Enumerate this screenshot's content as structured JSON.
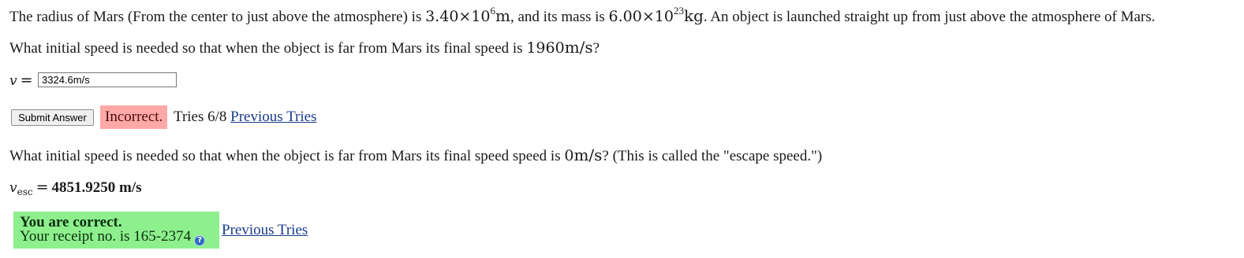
{
  "problem": {
    "intro_a": "The radius of Mars (From the center to just above the atmosphere) is ",
    "radius_mantissa": "3.40×10",
    "radius_exp": "6",
    "radius_unit": "m",
    "intro_b": ", and its mass is ",
    "mass_mantissa": "6.00×10",
    "mass_exp": "23",
    "mass_unit": "kg",
    "intro_c": ". An object is launched straight up from just above the atmosphere of Mars."
  },
  "part1": {
    "question_a": "What initial speed is needed so that when the object is far from Mars its final speed is ",
    "final_speed": "1960",
    "final_speed_unit": "m/s",
    "question_b": "?",
    "var": "v",
    "eq": "=",
    "input_value": "3324.6m/s",
    "submit_label": "Submit Answer",
    "status_label": "Incorrect.",
    "tries_text": "Tries 6/8",
    "previous_tries_label": "Previous Tries"
  },
  "part2": {
    "question_a": "What initial speed is needed so that when the object is far from Mars its final speed speed is ",
    "final_speed": "0",
    "final_speed_unit": "m/s",
    "question_b": "? (This is called the \"escape speed.\")",
    "var": "v",
    "var_sub": "esc",
    "eq": "=",
    "answer_value": "4851.9250 m/s",
    "correct_title": "You are correct.",
    "receipt_text": "Your receipt no. is 165-2374",
    "help_icon": "?",
    "previous_tries_label": "Previous Tries"
  },
  "colors": {
    "incorrect_bg": "#ffa8a8",
    "correct_bg": "#8df08d",
    "link": "#1a3a8a"
  },
  "icons": {
    "help": "help-icon"
  }
}
